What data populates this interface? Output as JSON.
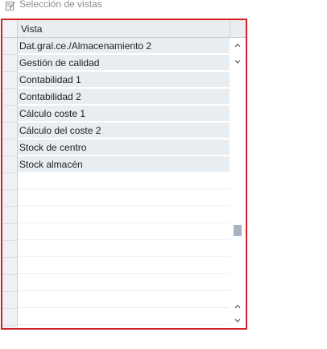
{
  "window": {
    "title": "Selección de vistas",
    "title_icon": "edit-list-icon"
  },
  "table": {
    "column_header": "Vista",
    "rows": [
      "Dat.gral.ce./Almacenamiento 2",
      "Gestión de calidad",
      "Contabilidad 1",
      "Contabilidad 2",
      "Cálculo coste 1",
      "Cálculo del coste 2",
      "Stock de centro",
      "Stock almacén"
    ]
  },
  "scrollbar": {
    "up_icon": "chevron-up-icon",
    "down_icon": "chevron-down-icon"
  },
  "colors": {
    "frame_border": "#d12027",
    "row_fill": "#e8edf2",
    "header_fill": "#eaeef2"
  }
}
